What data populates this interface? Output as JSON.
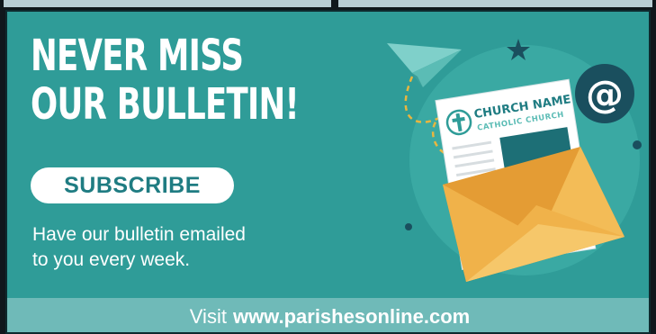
{
  "banner": {
    "headline_line1": "NEVER MISS",
    "headline_line2": "OUR BULLETIN!",
    "subscribe_label": "SUBSCRIBE",
    "tagline_line1": "Have our bulletin emailed",
    "tagline_line2": "to you every week."
  },
  "illustration": {
    "church_name": "CHURCH NAME",
    "church_subtitle": "CATHOLIC CHURCH",
    "at_symbol": "@",
    "icons": [
      "paper-plane-icon",
      "star-icon",
      "at-sign-icon",
      "cross-icon",
      "envelope-icon"
    ]
  },
  "footer": {
    "visit_label": "Visit",
    "url": "www.parishesonline.com"
  },
  "colors": {
    "banner_bg": "#2f9c98",
    "circle": "#3aa9a3",
    "footer_bg": "#6fbab8",
    "button_text": "#1f7c82",
    "envelope": "#f0b24a",
    "envelope_dark": "#e49c34",
    "at_circle": "#1a4f5e",
    "dashed_line": "#e8b640"
  }
}
